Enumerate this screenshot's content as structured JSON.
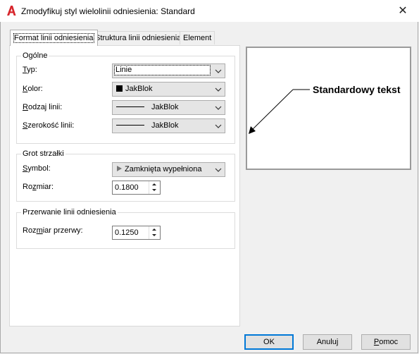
{
  "window": {
    "title": "Zmodyfikuj styl wielolinii odniesienia: Standard",
    "close_glyph": "✕"
  },
  "tabs": [
    {
      "label": "Format linii odniesienia",
      "active": true
    },
    {
      "label": "Struktura linii odniesienia",
      "active": false
    },
    {
      "label": "Element",
      "active": false
    }
  ],
  "general": {
    "title": "Ogólne",
    "type": {
      "label_ul": "T",
      "label_rest": "yp:",
      "value": "Linie"
    },
    "color": {
      "label_ul": "K",
      "label_rest": "olor:",
      "value": "JakBlok",
      "swatch_color": "#000000"
    },
    "linetype": {
      "label_ul": "R",
      "label_rest": "odzaj linii:",
      "value": "JakBlok"
    },
    "lineweight": {
      "label_ul": "S",
      "label_rest": "zerokość linii:",
      "value": "JakBlok"
    }
  },
  "arrowhead": {
    "title": "Grot strzałki",
    "symbol": {
      "label_pre": "",
      "label_ul": "S",
      "label_rest": "ymbol:",
      "value": "Zamknięta wypełniona"
    },
    "size": {
      "label_pre": "Ro",
      "label_ul": "z",
      "label_rest": "miar:",
      "value": "0.1800"
    }
  },
  "landing_break": {
    "title": "Przerwanie linii odniesienia",
    "break_size": {
      "label_pre": "Roz",
      "label_ul": "m",
      "label_rest": "iar przerwy:",
      "value": "0.1250"
    }
  },
  "preview": {
    "text": "Standardowy tekst"
  },
  "buttons": {
    "ok": "OK",
    "cancel": "Anuluj",
    "help_ul": "P",
    "help_rest": "omoc"
  }
}
